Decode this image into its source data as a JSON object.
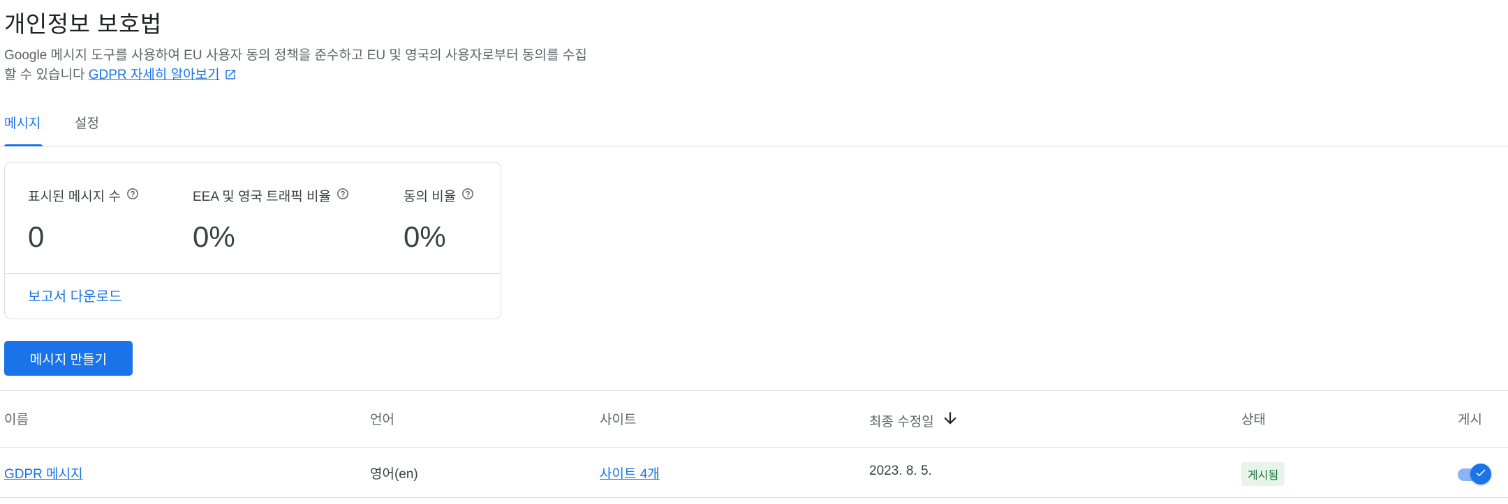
{
  "page": {
    "title": "개인정보 보호법",
    "description": "Google 메시지 도구를 사용하여 EU 사용자 동의 정책을 준수하고 EU 및 영국의 사용자로부터 동의를 수집할 수 있습니다",
    "learn_more_link": "GDPR 자세히 알아보기"
  },
  "tabs": [
    {
      "label": "메시지",
      "active": true
    },
    {
      "label": "설정",
      "active": false
    }
  ],
  "stats": {
    "items": [
      {
        "label": "표시된 메시지 수",
        "value": "0"
      },
      {
        "label": "EEA 및 영국 트래픽 비율",
        "value": "0%"
      },
      {
        "label": "동의 비율",
        "value": "0%"
      }
    ],
    "download_link": "보고서 다운로드"
  },
  "create_button": "메시지 만들기",
  "table": {
    "headers": [
      "이름",
      "언어",
      "사이트",
      "최종 수정일",
      "상태",
      "게시"
    ],
    "sort": {
      "column": "최종 수정일",
      "direction": "descending"
    },
    "rows": [
      {
        "name": "GDPR 메시지",
        "language": "영어(en)",
        "sites": "사이트 4개",
        "modified": "2023. 8. 5.",
        "status": "게시됨",
        "published": true
      }
    ]
  },
  "colors": {
    "accent": "#1a73e8",
    "status_published_bg": "#e6f4ea",
    "status_published_text": "#137333"
  }
}
